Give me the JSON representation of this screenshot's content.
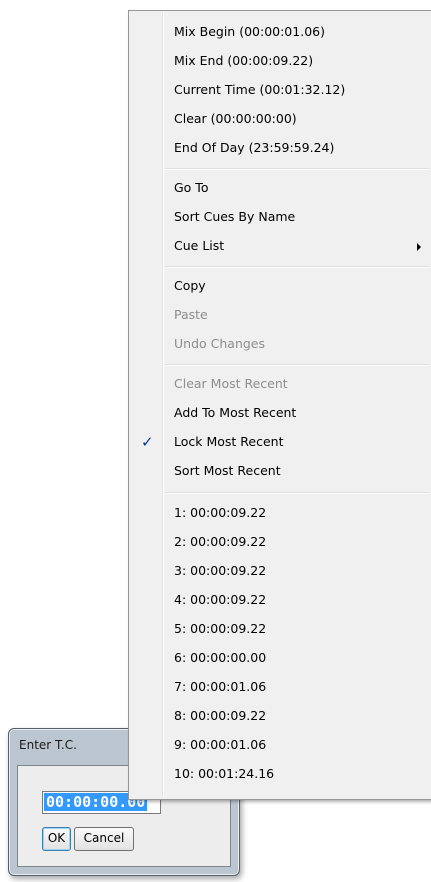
{
  "dialog": {
    "title": "Enter T.C.",
    "timecode_value": "00:00:00.00",
    "ok_label": "OK",
    "cancel_label": "Cancel"
  },
  "menu": {
    "group1": [
      "Mix Begin (00:00:01.06)",
      "Mix End (00:00:09.22)",
      "Current Time (00:01:32.12)",
      "Clear (00:00:00:00)",
      "End Of Day (23:59:59.24)"
    ],
    "group2": [
      "Go To",
      "Sort Cues By Name",
      "Cue List"
    ],
    "group3": [
      "Copy",
      "Paste",
      "Undo Changes"
    ],
    "group4": [
      "Clear Most Recent",
      "Add To Most Recent",
      "Lock Most Recent",
      "Sort Most Recent"
    ],
    "recent": [
      "1: 00:00:09.22",
      "2: 00:00:09.22",
      "3: 00:00:09.22",
      "4: 00:00:09.22",
      "5: 00:00:09.22",
      "6: 00:00:00.00",
      "7: 00:00:01.06",
      "8: 00:00:09.22",
      "9: 00:00:01.06",
      "10: 00:01:24.16"
    ],
    "check_glyph": "✓"
  }
}
